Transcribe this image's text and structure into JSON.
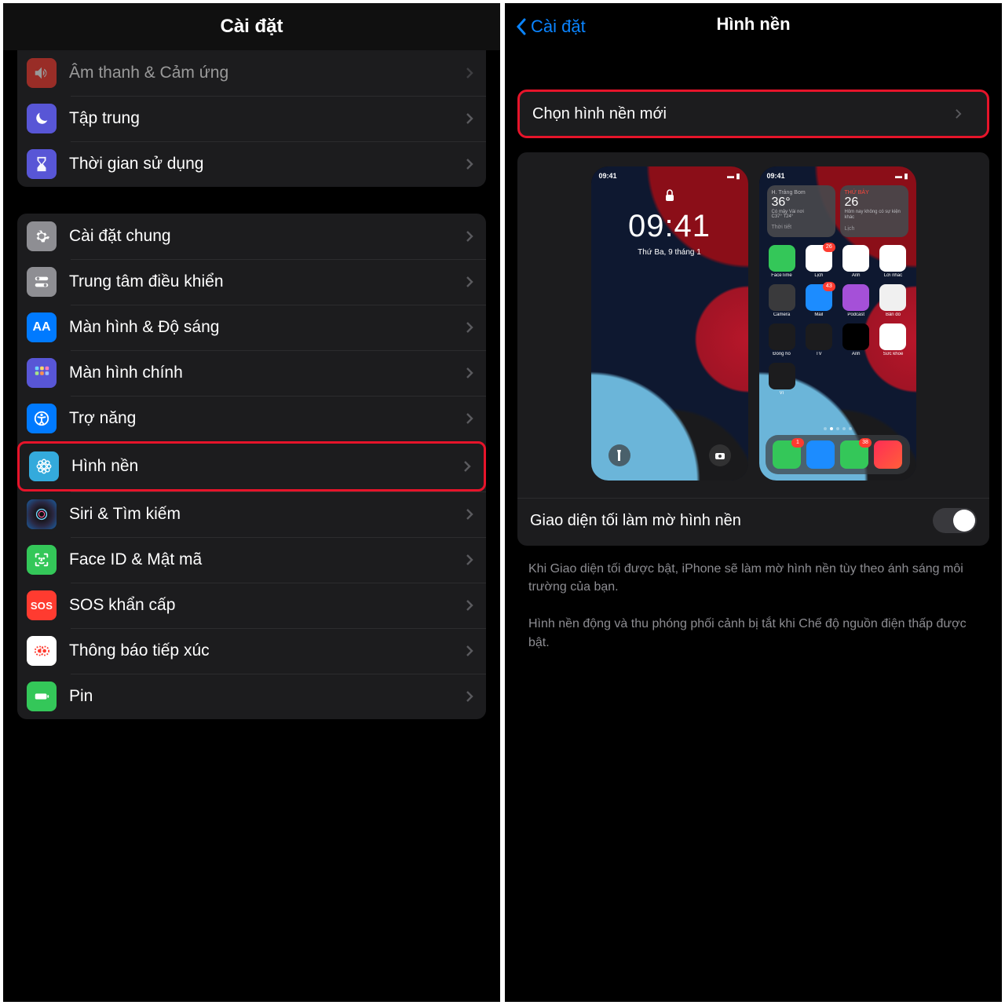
{
  "left": {
    "title": "Cài đặt",
    "group1": [
      {
        "label": "Âm thanh & Cảm ứng",
        "icon": "sound-icon",
        "bg": "bg-red"
      },
      {
        "label": "Tập trung",
        "icon": "moon-icon",
        "bg": "bg-purple"
      },
      {
        "label": "Thời gian sử dụng",
        "icon": "hourglass-icon",
        "bg": "bg-purple"
      }
    ],
    "group2": [
      {
        "label": "Cài đặt chung",
        "icon": "gear-icon",
        "bg": "bg-grey"
      },
      {
        "label": "Trung tâm điều khiển",
        "icon": "switches-icon",
        "bg": "bg-grey"
      },
      {
        "label": "Màn hình & Độ sáng",
        "icon": "display-icon",
        "bg": "bg-blue",
        "text": "AA"
      },
      {
        "label": "Màn hình chính",
        "icon": "grid-icon",
        "bg": "bg-grid"
      },
      {
        "label": "Trợ năng",
        "icon": "accessibility-icon",
        "bg": "bg-acc"
      },
      {
        "label": "Hình nền",
        "icon": "wallpaper-icon",
        "bg": "bg-wall",
        "highlight": true
      },
      {
        "label": "Siri & Tìm kiếm",
        "icon": "siri-icon",
        "bg": "bg-siri"
      },
      {
        "label": "Face ID & Mật mã",
        "icon": "faceid-icon",
        "bg": "bg-green"
      },
      {
        "label": "SOS khẩn cấp",
        "icon": "sos-icon",
        "bg": "bg-sos",
        "text": "SOS"
      },
      {
        "label": "Thông báo tiếp xúc",
        "icon": "exposure-icon",
        "bg": "bg-exp"
      },
      {
        "label": "Pin",
        "icon": "battery-icon",
        "bg": "bg-batt"
      }
    ]
  },
  "right": {
    "back": "Cài đặt",
    "title": "Hình nền",
    "choose": "Chọn hình nền mới",
    "lock": {
      "time": "09:41",
      "time2": "09:41",
      "date": "Thứ Ba, 9 tháng 1"
    },
    "weather": {
      "loc": "H. Trảng Bom",
      "temp": "36°",
      "line": "Có mây Vài nơi",
      "hl": "C37° T24°",
      "foot": "Thời tiết"
    },
    "cal": {
      "dow": "THỨ BẢY",
      "day": "26",
      "txt": "Hôm nay không có sự kiện khác",
      "foot": "Lịch"
    },
    "apps_r1": [
      {
        "n": "FaceTime",
        "c": "#34c759"
      },
      {
        "n": "Lịch",
        "c": "#fff",
        "badge": "26"
      },
      {
        "n": "Ảnh",
        "c": "#fff"
      },
      {
        "n": "Lời nhắc",
        "c": "#fff"
      }
    ],
    "apps_r2": [
      {
        "n": "Camera",
        "c": "#3a3a3c"
      },
      {
        "n": "Mail",
        "c": "#1c8cff",
        "badge": "43"
      },
      {
        "n": "Podcast",
        "c": "#a550d8"
      },
      {
        "n": "Bản đồ",
        "c": "#f0f0f0"
      }
    ],
    "apps_r3": [
      {
        "n": "Đồng hồ",
        "c": "#1c1c1e"
      },
      {
        "n": "TV",
        "c": "#1c1c1e"
      },
      {
        "n": "Ảnh",
        "c": "#000"
      },
      {
        "n": "Sức khỏe",
        "c": "#fff"
      }
    ],
    "apps_r4": [
      {
        "n": "Ví",
        "c": "#1c1c1e"
      }
    ],
    "dock": [
      {
        "c": "#34c759",
        "badge": "1"
      },
      {
        "c": "#1c8cff"
      },
      {
        "c": "#34c759",
        "badge": "38"
      },
      {
        "c": "linear-gradient(135deg,#ff2d55,#ff5e3a)"
      }
    ],
    "dim_label": "Giao diện tối làm mờ hình nền",
    "desc1": "Khi Giao diện tối được bật, iPhone sẽ làm mờ hình nền tùy theo ánh sáng môi trường của bạn.",
    "desc2": "Hình nền động và thu phóng phối cảnh bị tắt khi Chế độ nguồn điện thấp được bật."
  }
}
